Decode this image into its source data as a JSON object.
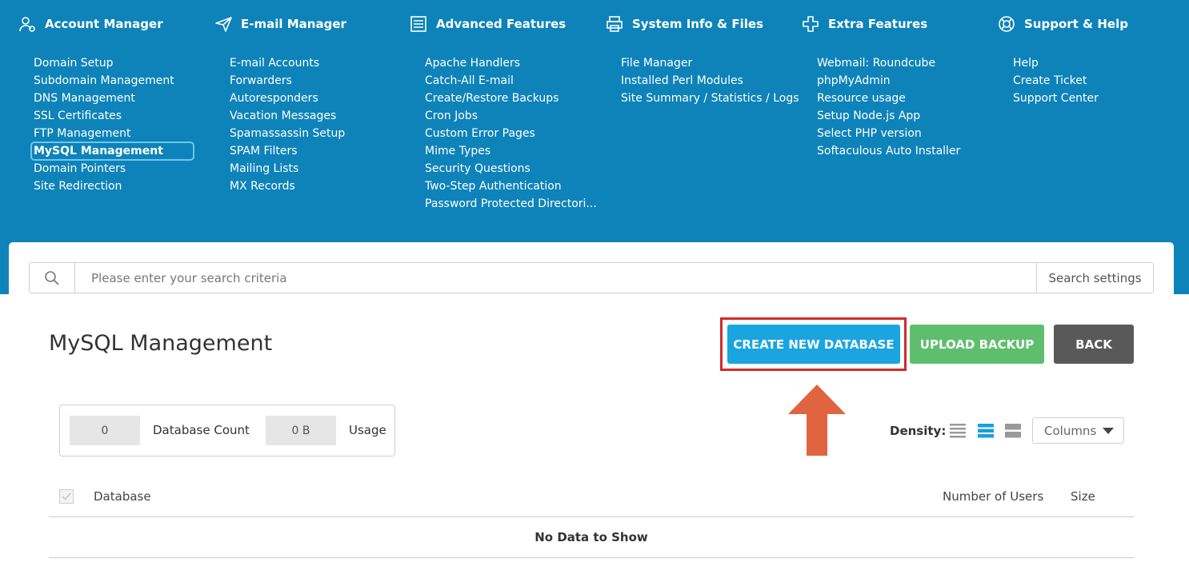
{
  "nav": {
    "columns": [
      {
        "heading": "Account Manager",
        "icon": "user-gear-icon",
        "items": [
          "Domain Setup",
          "Subdomain Management",
          "DNS Management",
          "SSL Certificates",
          "FTP Management",
          "MySQL Management",
          "Domain Pointers",
          "Site Redirection"
        ]
      },
      {
        "heading": "E-mail Manager",
        "icon": "paper-plane-icon",
        "items": [
          "E-mail Accounts",
          "Forwarders",
          "Autoresponders",
          "Vacation Messages",
          "Spamassassin Setup",
          "SPAM Filters",
          "Mailing Lists",
          "MX Records"
        ]
      },
      {
        "heading": "Advanced Features",
        "icon": "list-document-icon",
        "items": [
          "Apache Handlers",
          "Catch-All E-mail",
          "Create/Restore Backups",
          "Cron Jobs",
          "Custom Error Pages",
          "Mime Types",
          "Security Questions",
          "Two-Step Authentication",
          "Password Protected Directori..."
        ]
      },
      {
        "heading": "System Info & Files",
        "icon": "printer-icon",
        "items": [
          "File Manager",
          "Installed Perl Modules",
          "Site Summary / Statistics / Logs"
        ]
      },
      {
        "heading": "Extra Features",
        "icon": "plus-icon",
        "items": [
          "Webmail: Roundcube",
          "phpMyAdmin",
          "Resource usage",
          "Setup Node.js App",
          "Select PHP version",
          "Softaculous Auto Installer"
        ]
      },
      {
        "heading": "Support & Help",
        "icon": "lifebuoy-icon",
        "items": [
          "Help",
          "Create Ticket",
          "Support Center"
        ]
      }
    ],
    "active_item": "MySQL Management"
  },
  "search": {
    "placeholder": "Please enter your search criteria",
    "settings_label": "Search settings"
  },
  "page": {
    "title": "MySQL Management"
  },
  "buttons": {
    "create": "CREATE NEW DATABASE",
    "upload": "UPLOAD BACKUP",
    "back": "BACK"
  },
  "stats": {
    "db_count": "0",
    "db_count_label": "Database Count",
    "usage": "0 B",
    "usage_label": "Usage"
  },
  "density": {
    "label": "Density:",
    "selected": "medium"
  },
  "columns_select": {
    "label": "Columns"
  },
  "table": {
    "headers": {
      "database": "Database",
      "users": "Number of Users",
      "size": "Size"
    },
    "empty_text": "No Data to Show"
  },
  "colors": {
    "nav_bg": "#0e83b9",
    "primary": "#1aa5e0",
    "success": "#5fbe6e",
    "dark": "#595959",
    "highlight": "#d22a2a",
    "arrow": "#e0643f"
  }
}
